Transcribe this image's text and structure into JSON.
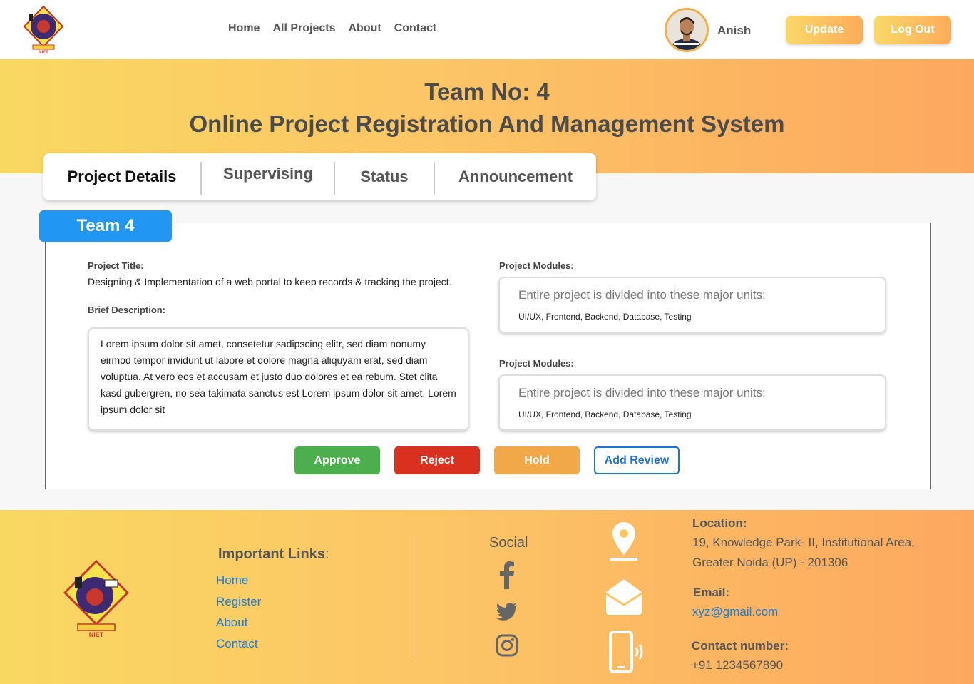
{
  "header": {
    "logo_caption": "NIET",
    "nav": [
      "Home",
      "All Projects",
      "About",
      "Contact"
    ],
    "username": "Anish",
    "update_label": "Update",
    "logout_label": "Log Out"
  },
  "banner": {
    "team_no": "Team No: 4",
    "project_title": "Online Project Registration And Management System"
  },
  "tabs": [
    "Project Details",
    "Supervising",
    "Status",
    "Announcement"
  ],
  "panel": {
    "team_badge": "Team 4",
    "project_title_label": "Project Title:",
    "project_title_value": "Designing & Implementation of a web portal to keep records & tracking the project.",
    "brief_label": "Brief Description:",
    "brief_text": "Lorem ipsum dolor sit amet, consetetur sadipscing elitr, sed diam nonumy eirmod tempor invidunt ut labore et dolore magna aliquyam erat, sed diam voluptua. At vero eos et accusam et justo duo dolores et ea rebum. Stet clita kasd gubergren, no sea takimata sanctus est Lorem ipsum dolor sit amet. Lorem ipsum dolor sit",
    "modules": [
      {
        "label": "Project Modules:",
        "heading": "Entire project is divided into these major units:",
        "list": "UI/UX, Frontend, Backend, Database, Testing"
      },
      {
        "label": "Project Modules:",
        "heading": "Entire project is divided into these major units:",
        "list": "UI/UX, Frontend, Backend, Database, Testing"
      }
    ],
    "buttons": {
      "approve": "Approve",
      "reject": "Reject",
      "hold": "Hold",
      "review": "Add Review"
    }
  },
  "footer": {
    "logo_caption": "NIET",
    "important_links_title": "Important Links",
    "links": [
      "Home",
      "Register",
      "About",
      "Contact"
    ],
    "social_title": "Social",
    "location_label": "Location:",
    "location_line1": "19, Knowledge Park- II, Institutional Area,",
    "location_line2": "Greater Noida (UP) - 201306",
    "email_label": "Email:",
    "email": "xyz@gmail.com",
    "contact_label": "Contact number:",
    "contact": "+91 1234567890"
  },
  "colors": {
    "gradient_start": "#f9d862",
    "gradient_end": "#fda85f",
    "badge_blue": "#2196f3",
    "approve": "#4cae4c",
    "reject": "#d9301f",
    "hold": "#f0a848",
    "link": "#1f7bd8"
  },
  "icons": [
    "map-pin-icon",
    "mail-open-icon",
    "phone-icon",
    "facebook-icon",
    "twitter-icon",
    "instagram-icon"
  ]
}
